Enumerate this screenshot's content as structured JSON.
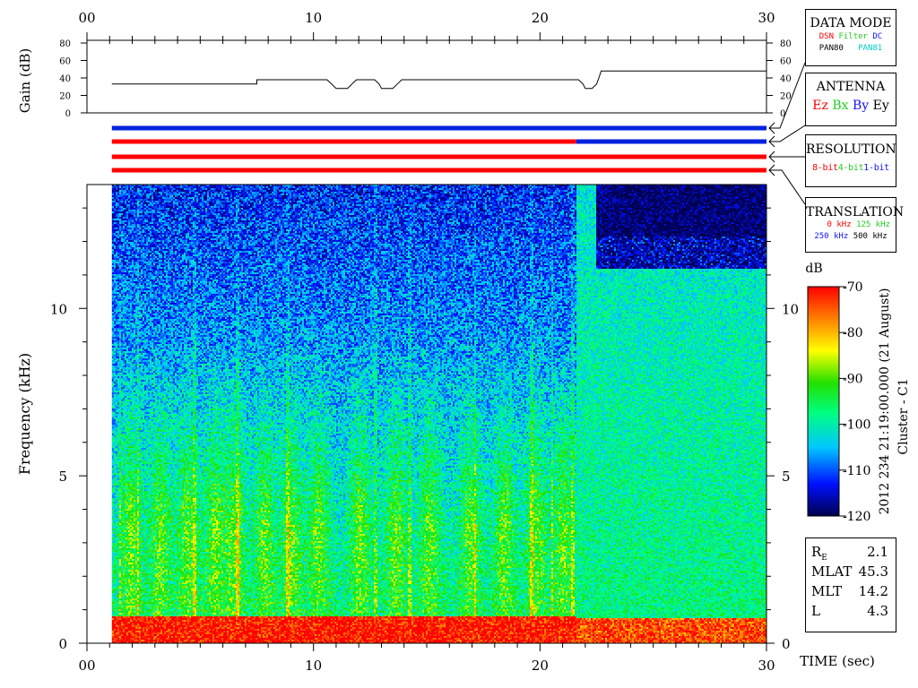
{
  "colors": {
    "blue_bar": "#0022dd",
    "red_bar": "#ff0000",
    "text_red": "#ff0000",
    "text_green": "#22cc22",
    "text_blue": "#1111ff",
    "text_cyan": "#00cccc",
    "colorbar_stops": [
      "#000050",
      "#0010ff",
      "#00c8ff",
      "#00ff80",
      "#22e000",
      "#ffff00",
      "#ff8000",
      "#ff0000"
    ]
  },
  "top_axis": {
    "ticks": [
      "00",
      "10",
      "20",
      "30"
    ]
  },
  "gain_panel": {
    "ylabel": "Gain (dB)",
    "yticks": [
      "0",
      "20",
      "40",
      "60",
      "80"
    ]
  },
  "data_mode": {
    "title": "DATA MODE",
    "items": [
      {
        "text": "DSN",
        "color": "#ff0000"
      },
      {
        "text": "Filter",
        "color": "#22cc22"
      },
      {
        "text": "DC",
        "color": "#1111ff"
      },
      {
        "text": "PAN80",
        "color": "#000000"
      },
      {
        "text": "PAN81",
        "color": "#00cccc"
      }
    ]
  },
  "antenna": {
    "title": "ANTENNA",
    "items": [
      {
        "text": "Ez",
        "color": "#ff0000"
      },
      {
        "text": "Bx",
        "color": "#22cc22"
      },
      {
        "text": "By",
        "color": "#1111ff"
      },
      {
        "text": "Ey",
        "color": "#000000"
      }
    ]
  },
  "resolution": {
    "title": "RESOLUTION",
    "items": [
      {
        "text": "8-bit",
        "color": "#ff0000"
      },
      {
        "text": "4-bit",
        "color": "#22cc22"
      },
      {
        "text": "1-bit",
        "color": "#1111ff"
      }
    ]
  },
  "translation": {
    "title": "TRANSLATION",
    "items": [
      {
        "text": "0 kHz",
        "color": "#ff0000"
      },
      {
        "text": "125 kHz",
        "color": "#22cc22"
      },
      {
        "text": "250 kHz",
        "color": "#1111ff"
      },
      {
        "text": "500 kHz",
        "color": "#000000"
      }
    ]
  },
  "spectrogram": {
    "ylabel": "Frequency (kHz)",
    "yticks": [
      "0",
      "5",
      "10"
    ],
    "xticks": [
      "00",
      "10",
      "20",
      "30"
    ],
    "xlabel": "TIME (sec)"
  },
  "colorbar": {
    "unit": "dB",
    "ticks": [
      "-70",
      "-80",
      "-90",
      "-100",
      "-110",
      "-120"
    ]
  },
  "side_caption": {
    "line1": "2012 234 21:19:00.000 (21 August)",
    "line2": "Cluster - C1"
  },
  "coords": [
    {
      "label": "R",
      "sub": "E",
      "value": "2.1"
    },
    {
      "label": "MLAT",
      "sub": "",
      "value": "45.3"
    },
    {
      "label": "MLT",
      "sub": "",
      "value": "14.2"
    },
    {
      "label": "L",
      "sub": "",
      "value": "4.3"
    }
  ],
  "chart_data": {
    "type": "heatmap",
    "x": {
      "label": "TIME (sec)",
      "range": [
        0,
        30
      ],
      "ticks": [
        0,
        10,
        20,
        30
      ]
    },
    "y": {
      "label": "Frequency (kHz)",
      "range": [
        0,
        13.7
      ],
      "ticks": [
        0,
        5,
        10
      ]
    },
    "colorscale": {
      "label": "dB",
      "range": [
        -120,
        -70
      ],
      "ticks": [
        -70,
        -80,
        -90,
        -100,
        -110,
        -120
      ]
    },
    "data_start_time": 1.1,
    "data_end_time": 30,
    "mode_change_time": 21.6,
    "gain_series": {
      "ylabel": "Gain (dB)",
      "ylim": [
        0,
        80
      ],
      "points": [
        [
          1.1,
          33
        ],
        [
          7.5,
          33
        ],
        [
          7.5,
          38
        ],
        [
          10.6,
          38
        ],
        [
          10.8,
          33
        ],
        [
          11.0,
          28
        ],
        [
          11.5,
          28
        ],
        [
          11.7,
          33
        ],
        [
          11.9,
          38
        ],
        [
          12.7,
          38
        ],
        [
          12.9,
          33
        ],
        [
          13.0,
          28
        ],
        [
          13.5,
          28
        ],
        [
          13.7,
          33
        ],
        [
          13.9,
          38
        ],
        [
          21.7,
          38
        ],
        [
          21.9,
          33
        ],
        [
          22.0,
          28
        ],
        [
          22.3,
          28
        ],
        [
          22.5,
          33
        ],
        [
          22.6,
          40
        ],
        [
          22.7,
          48
        ],
        [
          30,
          48
        ]
      ]
    },
    "bars": [
      {
        "name": "DATA MODE",
        "segments": [
          {
            "from": 1.1,
            "to": 30,
            "color": "blue"
          }
        ]
      },
      {
        "name": "ANTENNA",
        "segments": [
          {
            "from": 1.1,
            "to": 21.6,
            "color": "red"
          },
          {
            "from": 21.6,
            "to": 30,
            "color": "blue"
          }
        ]
      },
      {
        "name": "RESOLUTION",
        "segments": [
          {
            "from": 1.1,
            "to": 30,
            "color": "red"
          }
        ]
      },
      {
        "name": "TRANSLATION",
        "segments": [
          {
            "from": 1.1,
            "to": 30,
            "color": "red"
          }
        ]
      }
    ]
  }
}
